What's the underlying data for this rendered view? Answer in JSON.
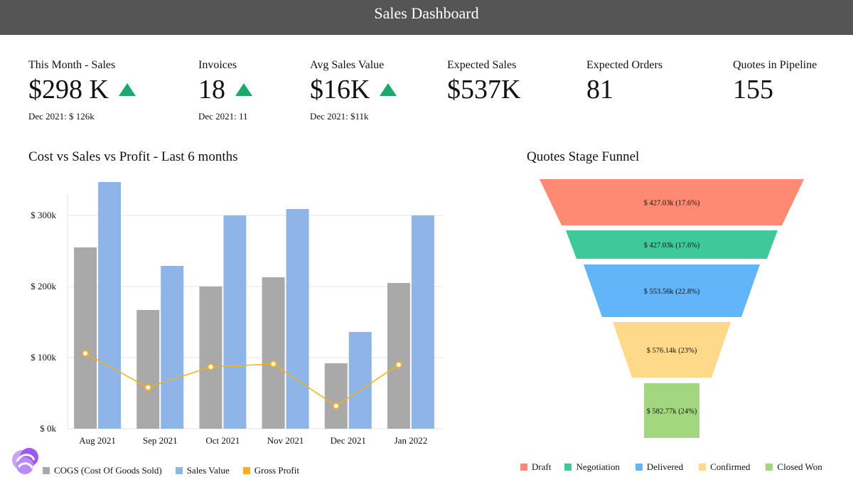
{
  "header": {
    "title": "Sales Dashboard"
  },
  "kpis": [
    {
      "label": "This Month - Sales",
      "value": "$298 K",
      "sub": "Dec 2021: $ 126k",
      "trend": "up"
    },
    {
      "label": "Invoices",
      "value": "18",
      "sub": "Dec 2021: 11",
      "trend": "up"
    },
    {
      "label": "Avg Sales Value",
      "value": "$16K",
      "sub": "Dec 2021: $11k",
      "trend": "up"
    },
    {
      "label": "Expected Sales",
      "value": "$537K",
      "sub": "",
      "trend": ""
    },
    {
      "label": "Expected Orders",
      "value": "81",
      "sub": "",
      "trend": ""
    },
    {
      "label": "Quotes in Pipeline",
      "value": "155",
      "sub": "",
      "trend": ""
    }
  ],
  "colors": {
    "trend_up": "#1aa86e",
    "cogs": "#a9a9a9",
    "sales": "#8fb4e8",
    "profit": "#f2b01e"
  },
  "chart_data": [
    {
      "type": "bar",
      "title": "Cost vs Sales vs Profit - Last 6 months",
      "categories": [
        "Aug 2021",
        "Sep 2021",
        "Oct 2021",
        "Nov 2021",
        "Dec 2021",
        "Jan 2022"
      ],
      "y_ticks": [
        "$ 0k",
        "$ 100k",
        "$ 200k",
        "$ 300k"
      ],
      "ylim": [
        0,
        350
      ],
      "grid": true,
      "legend_position": "bottom",
      "series": [
        {
          "name": "COGS (Cost Of Goods Sold)",
          "type": "bar",
          "color": "#a9a9a9",
          "values": [
            255,
            167,
            200,
            213,
            92,
            205
          ]
        },
        {
          "name": "Sales Value",
          "type": "bar",
          "color": "#8fb4e8",
          "values": [
            347,
            229,
            300,
            309,
            136,
            300
          ]
        },
        {
          "name": "Gross Profit",
          "type": "line",
          "color": "#f2b01e",
          "values": [
            106,
            58,
            87,
            91,
            32,
            90
          ]
        }
      ]
    },
    {
      "type": "funnel",
      "title": "Quotes Stage Funnel",
      "legend_position": "bottom",
      "stages": [
        {
          "name": "Draft",
          "value": 427.03,
          "label": "$ 427.03k (17.6%)",
          "color": "#ff8a73"
        },
        {
          "name": "Negotiation",
          "value": 427.03,
          "label": "$ 427.03k (17.6%)",
          "color": "#3fc99a"
        },
        {
          "name": "Delivered",
          "value": 553.56,
          "label": "$ 553.56k (22.8%)",
          "color": "#62b5f8"
        },
        {
          "name": "Confirmed",
          "value": 576.14,
          "label": "$ 576.14k (23%)",
          "color": "#ffd98a"
        },
        {
          "name": "Closed Won",
          "value": 582.77,
          "label": "$ 582.77k (24%)",
          "color": "#a2d67f"
        }
      ]
    }
  ]
}
